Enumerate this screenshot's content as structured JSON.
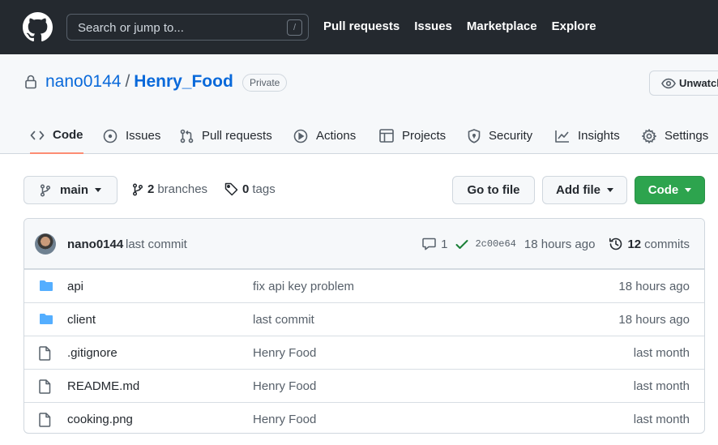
{
  "header": {
    "search_placeholder": "Search or jump to...",
    "search_key": "/",
    "nav": [
      "Pull requests",
      "Issues",
      "Marketplace",
      "Explore"
    ]
  },
  "repo": {
    "owner": "nano0144",
    "separator": "/",
    "name": "Henry_Food",
    "visibility": "Private",
    "unwatch_label": "Unwatch"
  },
  "tabs": [
    {
      "label": "Code",
      "icon": "code-icon",
      "active": true
    },
    {
      "label": "Issues",
      "icon": "issue-icon"
    },
    {
      "label": "Pull requests",
      "icon": "pull-request-icon"
    },
    {
      "label": "Actions",
      "icon": "play-icon"
    },
    {
      "label": "Projects",
      "icon": "table-icon"
    },
    {
      "label": "Security",
      "icon": "shield-icon"
    },
    {
      "label": "Insights",
      "icon": "graph-icon"
    },
    {
      "label": "Settings",
      "icon": "gear-icon"
    }
  ],
  "toolbar": {
    "branch": "main",
    "branches_count": "2",
    "branches_label": "branches",
    "tags_count": "0",
    "tags_label": "tags",
    "go_to_file": "Go to file",
    "add_file": "Add file",
    "code": "Code"
  },
  "latest_commit": {
    "author": "nano0144",
    "message": "last commit",
    "comments": "1",
    "sha": "2c00e64",
    "time": "18 hours ago",
    "commits_count": "12",
    "commits_label": "commits"
  },
  "files": [
    {
      "type": "folder",
      "name": "api",
      "message": "fix api key problem",
      "date": "18 hours ago"
    },
    {
      "type": "folder",
      "name": "client",
      "message": "last commit",
      "date": "18 hours ago"
    },
    {
      "type": "file",
      "name": ".gitignore",
      "message": "Henry Food",
      "date": "last month"
    },
    {
      "type": "file",
      "name": "README.md",
      "message": "Henry Food",
      "date": "last month"
    },
    {
      "type": "file",
      "name": "cooking.png",
      "message": "Henry Food",
      "date": "last month"
    }
  ],
  "colors": {
    "header_bg": "#24292f",
    "link": "#0969da",
    "primary_button": "#2da44e",
    "active_tab_underline": "#fd8c73",
    "folder": "#54aeff",
    "check": "#1a7f37"
  }
}
